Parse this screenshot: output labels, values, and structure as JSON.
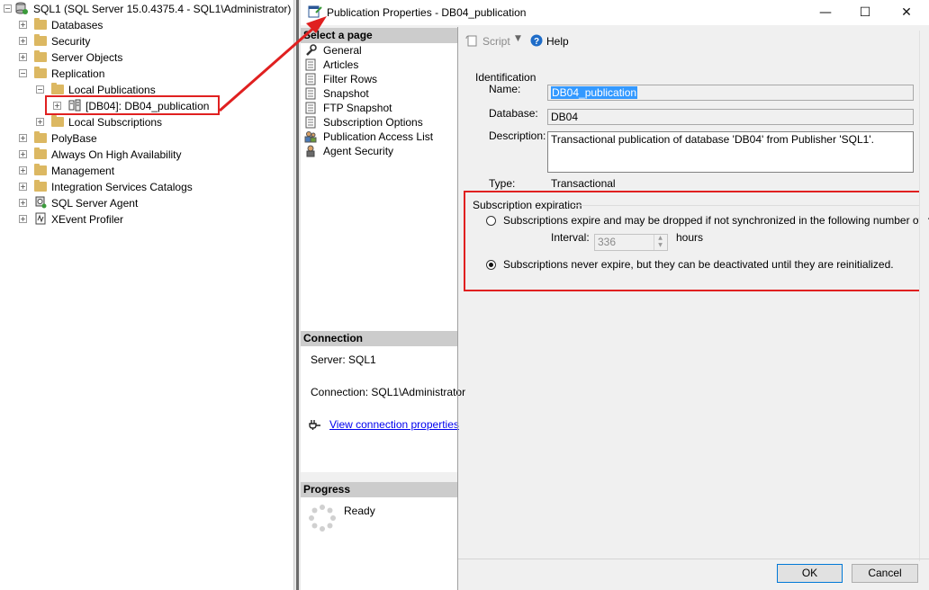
{
  "explorer": {
    "server_label": "SQL1 (SQL Server 15.0.4375.4 - SQL1\\Administrator)",
    "items": [
      {
        "label": "Databases",
        "expander": "+"
      },
      {
        "label": "Security",
        "expander": "+"
      },
      {
        "label": "Server Objects",
        "expander": "+"
      },
      {
        "label": "Replication",
        "expander": "−"
      },
      {
        "label": "Local Publications",
        "expander": "−"
      },
      {
        "label": "[DB04]: DB04_publication",
        "expander": "+"
      },
      {
        "label": "Local Subscriptions",
        "expander": "+"
      },
      {
        "label": "PolyBase",
        "expander": "+"
      },
      {
        "label": "Always On High Availability",
        "expander": "+"
      },
      {
        "label": "Management",
        "expander": "+"
      },
      {
        "label": "Integration Services Catalogs",
        "expander": "+"
      },
      {
        "label": "SQL Server Agent",
        "expander": "+"
      },
      {
        "label": "XEvent Profiler",
        "expander": "+"
      }
    ]
  },
  "dialog": {
    "title": "Publication Properties - DB04_publication",
    "window_buttons": {
      "minimize": "—",
      "maximize": "☐",
      "close": "✕"
    },
    "select_page_header": "Select a page",
    "pages": [
      {
        "label": "General",
        "icon": "wrench-icon"
      },
      {
        "label": "Articles",
        "icon": "page-icon"
      },
      {
        "label": "Filter Rows",
        "icon": "page-icon"
      },
      {
        "label": "Snapshot",
        "icon": "page-icon"
      },
      {
        "label": "FTP Snapshot",
        "icon": "page-icon"
      },
      {
        "label": "Subscription Options",
        "icon": "page-icon"
      },
      {
        "label": "Publication Access List",
        "icon": "users-icon"
      },
      {
        "label": "Agent Security",
        "icon": "agent-icon"
      }
    ],
    "connection_header": "Connection",
    "server_text": "Server: SQL1",
    "connection_text": "Connection: SQL1\\Administrator",
    "view_connection_link": "View connection properties",
    "progress_header": "Progress",
    "progress_status": "Ready",
    "toolbar": {
      "script_label": "Script",
      "help_label": "Help"
    },
    "identification": {
      "group_label": "Identification",
      "name_label": "Name:",
      "name_value": "DB04_publication",
      "database_label": "Database:",
      "database_value": "DB04",
      "description_label": "Description:",
      "description_value": "Transactional publication of database 'DB04' from Publisher 'SQL1'.",
      "type_label": "Type:",
      "type_value": "Transactional"
    },
    "expiration": {
      "group_label": "Subscription expiration",
      "option_expire": "Subscriptions expire and may be dropped if not synchronized in the following number of hours:",
      "interval_label": "Interval:",
      "interval_value": "336",
      "hours_label": "hours",
      "option_never": "Subscriptions never expire, but they can be deactivated until they are reinitialized.",
      "selected": "never"
    },
    "ok_label": "OK",
    "cancel_label": "Cancel"
  },
  "colors": {
    "highlight_red": "#e02020",
    "selection_blue": "#3399ff",
    "link_blue": "#0000ee"
  }
}
